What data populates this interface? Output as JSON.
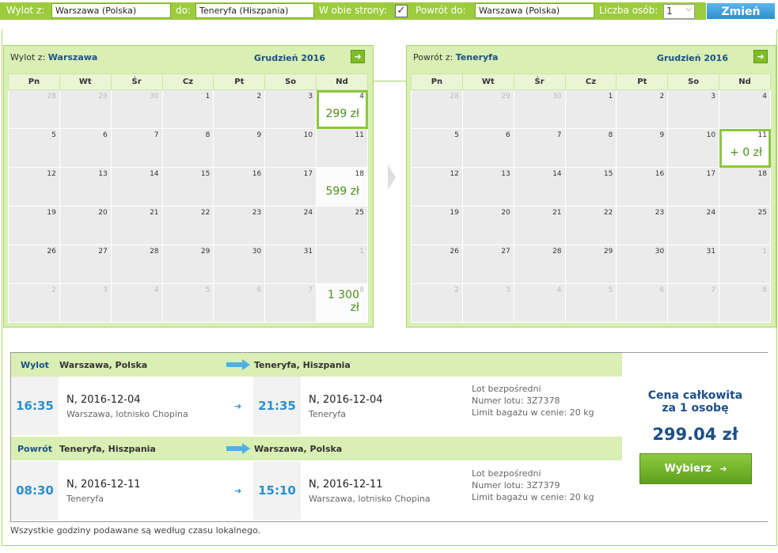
{
  "search": {
    "from_label": "Wylot z:",
    "from_value": "Warszawa (Polska)",
    "to_label": "do:",
    "to_value": "Teneryfa (Hiszpania)",
    "roundtrip_label": "W obie strony:",
    "roundtrip_checked": "✓",
    "return_label": "Powrót do:",
    "return_value": "Warszawa (Polska)",
    "persons_label": "Liczba osób:",
    "persons_value": "1",
    "submit_label": "Zmień"
  },
  "calendars": [
    {
      "title_prefix": "Wylot z:",
      "title_city": "Warszawa",
      "month": "Grudzień 2016",
      "weekdays": [
        "Pn",
        "Wt",
        "Śr",
        "Cz",
        "Pt",
        "So",
        "Nd"
      ],
      "weeks": [
        [
          {
            "d": "28",
            "o": true
          },
          {
            "d": "29",
            "o": true
          },
          {
            "d": "30",
            "o": true
          },
          {
            "d": "1"
          },
          {
            "d": "2"
          },
          {
            "d": "3"
          },
          {
            "d": "4",
            "p": "299 zł",
            "sel": true
          }
        ],
        [
          {
            "d": "5"
          },
          {
            "d": "6"
          },
          {
            "d": "7"
          },
          {
            "d": "8"
          },
          {
            "d": "9"
          },
          {
            "d": "10"
          },
          {
            "d": "11"
          }
        ],
        [
          {
            "d": "12"
          },
          {
            "d": "13"
          },
          {
            "d": "14"
          },
          {
            "d": "15"
          },
          {
            "d": "16"
          },
          {
            "d": "17"
          },
          {
            "d": "18",
            "p": "599 zł"
          }
        ],
        [
          {
            "d": "19"
          },
          {
            "d": "20"
          },
          {
            "d": "21"
          },
          {
            "d": "22"
          },
          {
            "d": "23"
          },
          {
            "d": "24"
          },
          {
            "d": "25"
          }
        ],
        [
          {
            "d": "26"
          },
          {
            "d": "27"
          },
          {
            "d": "28"
          },
          {
            "d": "29"
          },
          {
            "d": "30"
          },
          {
            "d": "31"
          },
          {
            "d": "1",
            "o": true
          }
        ],
        [
          {
            "d": "2",
            "o": true
          },
          {
            "d": "3",
            "o": true
          },
          {
            "d": "4",
            "o": true
          },
          {
            "d": "5",
            "o": true
          },
          {
            "d": "6",
            "o": true
          },
          {
            "d": "7",
            "o": true
          },
          {
            "d": "8",
            "o": true,
            "p": "1 300 zł"
          }
        ]
      ]
    },
    {
      "title_prefix": "Powrót z:",
      "title_city": "Teneryfa",
      "month": "Grudzień 2016",
      "weekdays": [
        "Pn",
        "Wt",
        "Śr",
        "Cz",
        "Pt",
        "So",
        "Nd"
      ],
      "weeks": [
        [
          {
            "d": "28",
            "o": true
          },
          {
            "d": "29",
            "o": true
          },
          {
            "d": "30",
            "o": true
          },
          {
            "d": "1"
          },
          {
            "d": "2"
          },
          {
            "d": "3"
          },
          {
            "d": "4"
          }
        ],
        [
          {
            "d": "5"
          },
          {
            "d": "6"
          },
          {
            "d": "7"
          },
          {
            "d": "8"
          },
          {
            "d": "9"
          },
          {
            "d": "10"
          },
          {
            "d": "11",
            "p": "+ 0 zł",
            "sel": true
          }
        ],
        [
          {
            "d": "12"
          },
          {
            "d": "13"
          },
          {
            "d": "14"
          },
          {
            "d": "15"
          },
          {
            "d": "16"
          },
          {
            "d": "17"
          },
          {
            "d": "18"
          }
        ],
        [
          {
            "d": "19"
          },
          {
            "d": "20"
          },
          {
            "d": "21"
          },
          {
            "d": "22"
          },
          {
            "d": "23"
          },
          {
            "d": "24"
          },
          {
            "d": "25"
          }
        ],
        [
          {
            "d": "26"
          },
          {
            "d": "27"
          },
          {
            "d": "28"
          },
          {
            "d": "29"
          },
          {
            "d": "30"
          },
          {
            "d": "31"
          },
          {
            "d": "1",
            "o": true
          }
        ],
        [
          {
            "d": "2",
            "o": true
          },
          {
            "d": "3",
            "o": true
          },
          {
            "d": "4",
            "o": true
          },
          {
            "d": "5",
            "o": true
          },
          {
            "d": "6",
            "o": true
          },
          {
            "d": "7",
            "o": true
          },
          {
            "d": "8",
            "o": true
          }
        ]
      ]
    }
  ],
  "outbound": {
    "label": "Wylot",
    "from": "Warszawa, Polska",
    "to": "Teneryfa, Hiszpania",
    "dep_time": "16:35",
    "dep_date": "N, 2016-12-04",
    "dep_place": "Warszawa, lotnisko Chopina",
    "arr_time": "21:35",
    "arr_date": "N, 2016-12-04",
    "arr_place": "Teneryfa",
    "info1": "Lot bezpośredni",
    "info2": "Numer lotu: 3Z7378",
    "info3": "Limit bagażu w cenie: 20 kg"
  },
  "inbound": {
    "label": "Powrót",
    "from": "Teneryfa, Hiszpania",
    "to": "Warszawa, Polska",
    "dep_time": "08:30",
    "dep_date": "N, 2016-12-11",
    "dep_place": "Teneryfa",
    "arr_time": "15:10",
    "arr_date": "N, 2016-12-11",
    "arr_place": "Warszawa, lotnisko Chopina",
    "info1": "Lot bezpośredni",
    "info2": "Numer lotu: 3Z7379",
    "info3": "Limit bagażu w cenie: 20 kg"
  },
  "price": {
    "label_line1": "Cena całkowita",
    "label_line2": "za 1 osobę",
    "value": "299.04 zł",
    "select_label": "Wybierz"
  },
  "note": "Wszystkie godziny podawane są według czasu lokalnego.",
  "colors": {
    "accent_green": "#9ccc3d",
    "calendar_bg": "#d9efb3",
    "time_blue": "#2c8fcd",
    "title_navy": "#1b4f8a"
  }
}
